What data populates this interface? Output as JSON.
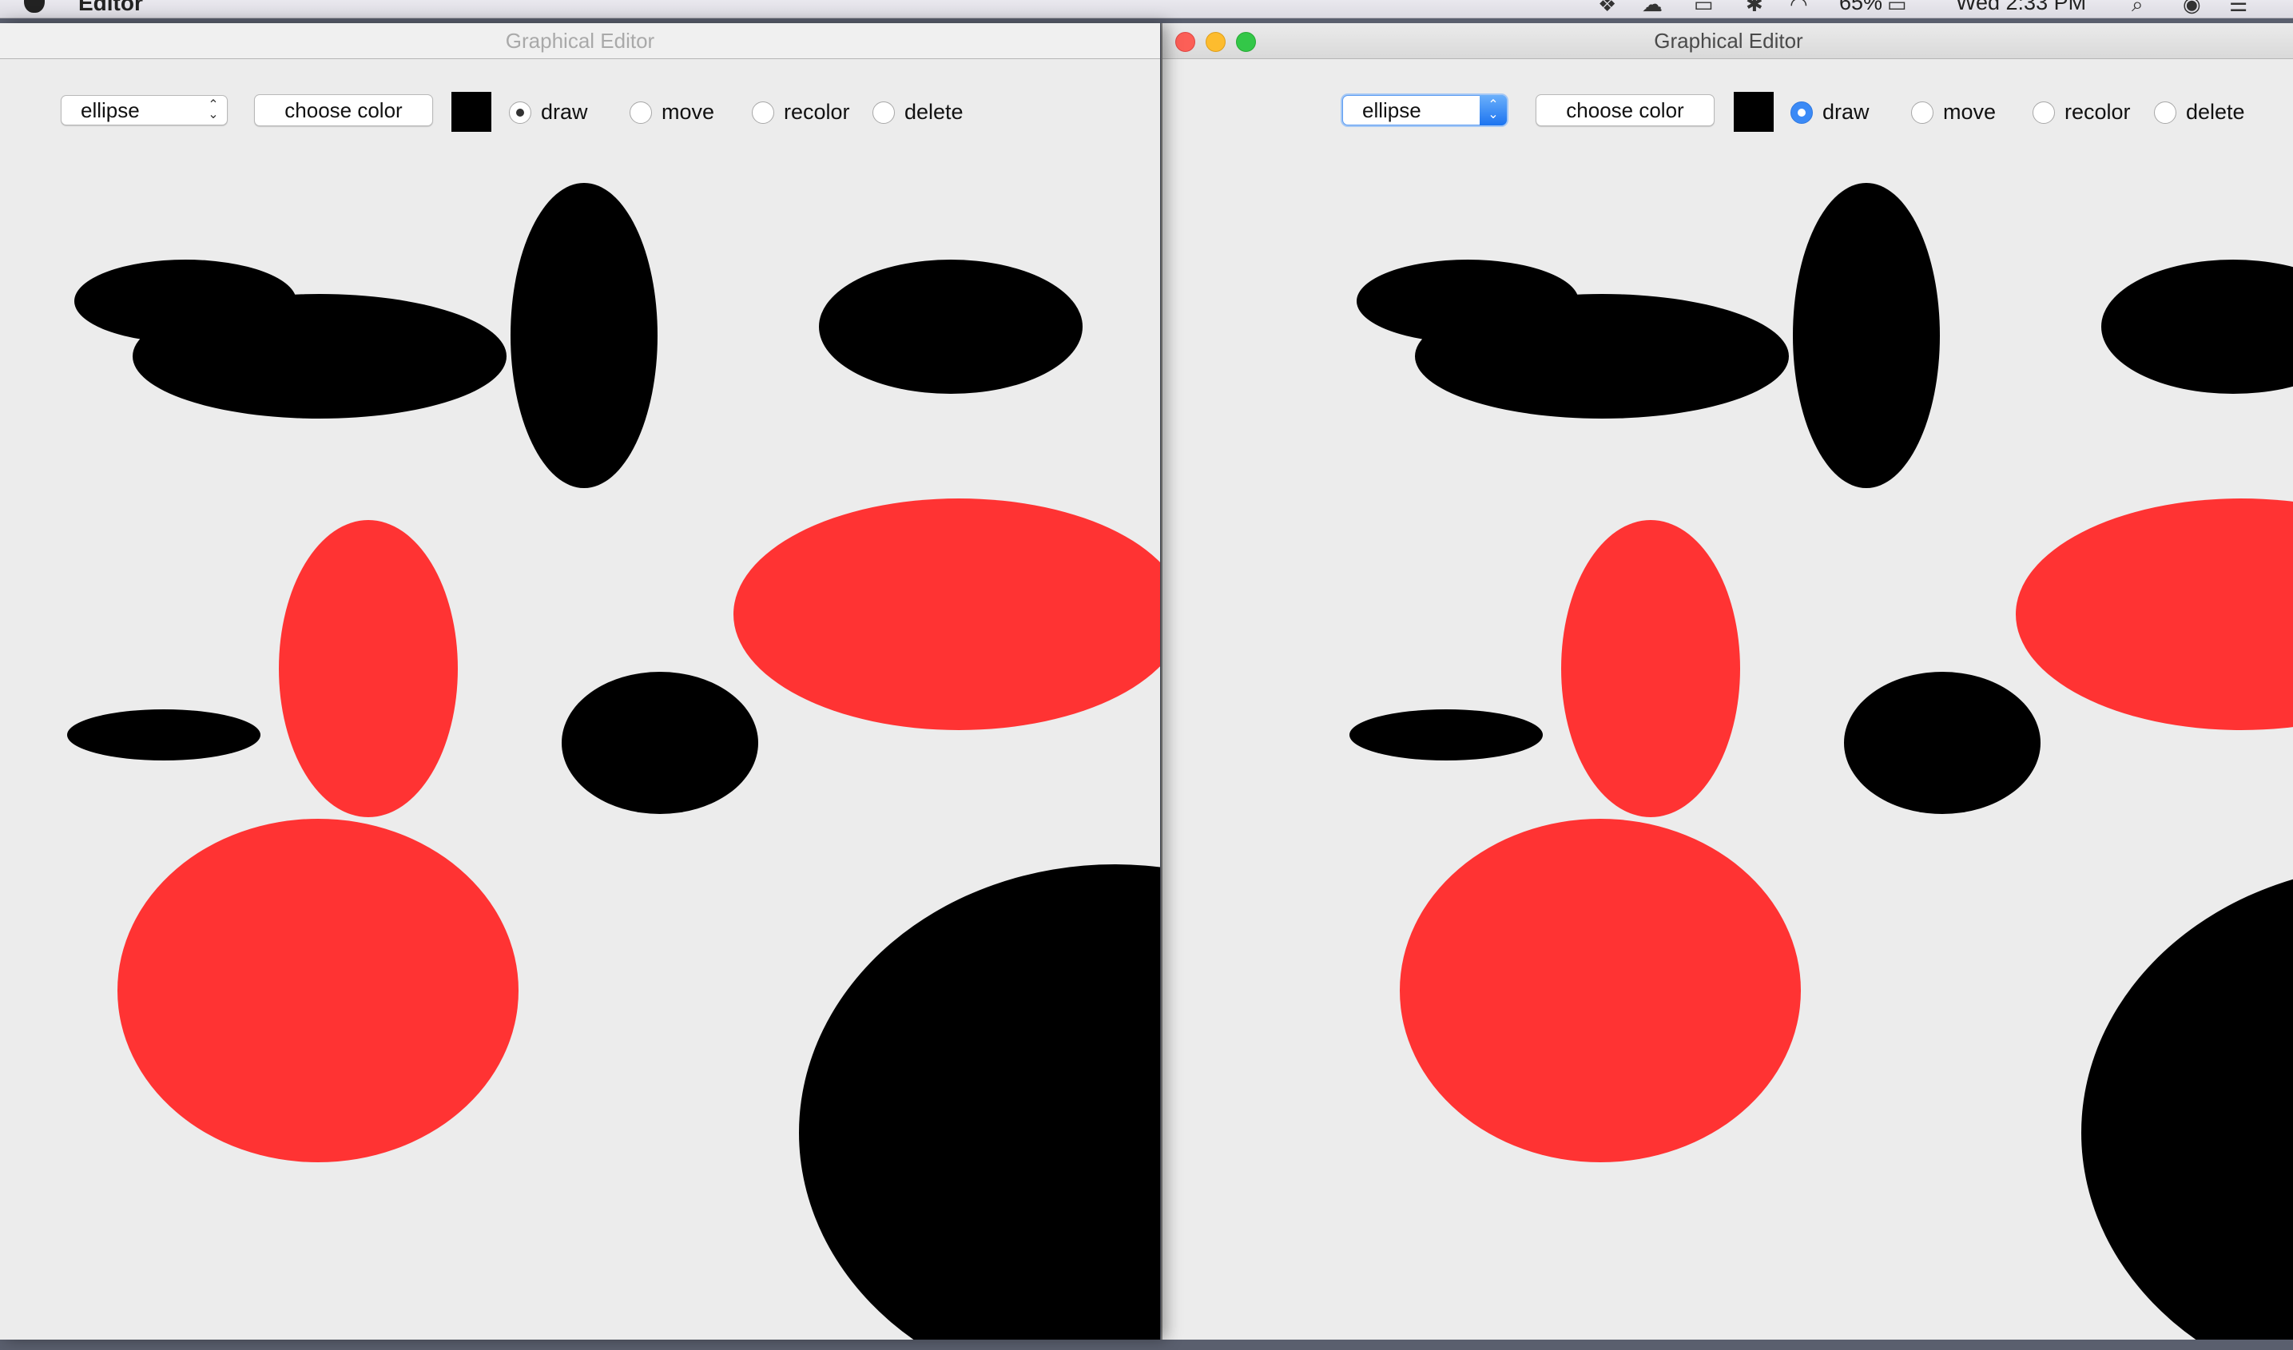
{
  "menubar": {
    "app_name": "Editor",
    "battery": "65%",
    "clock": "Wed 2:33 PM"
  },
  "windows": [
    {
      "title": "Graphical Editor",
      "shape_select": "ellipse",
      "color_button": "choose color",
      "modes": [
        "draw",
        "move",
        "recolor",
        "delete"
      ],
      "selected_mode": "draw"
    },
    {
      "title": "Graphical Editor",
      "shape_select": "ellipse",
      "color_button": "choose color",
      "modes": [
        "draw",
        "move",
        "recolor",
        "delete"
      ],
      "selected_mode": "draw"
    }
  ],
  "colors": {
    "canvas_bg": "#ececec",
    "current_color": "#000000",
    "red": "#ff3333",
    "black": "#000000"
  }
}
